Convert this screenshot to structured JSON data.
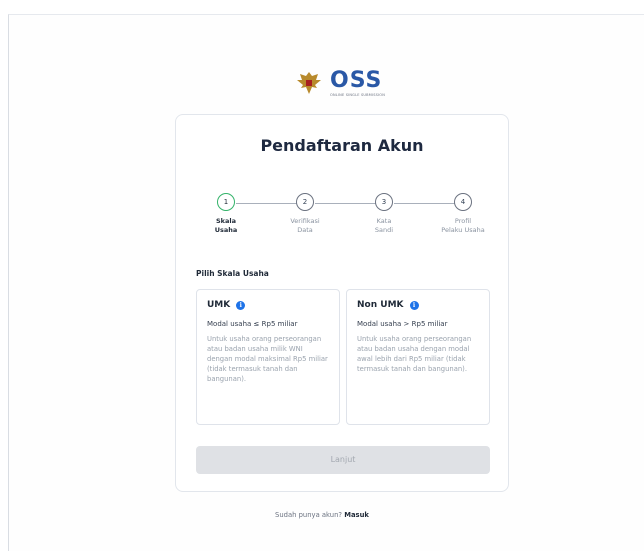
{
  "logo": {
    "brand": "OSS",
    "subtitle": "ONLINE SINGLE SUBMISSION"
  },
  "card": {
    "title": "Pendaftaran Akun",
    "steps": [
      {
        "number": "1",
        "label": "Skala\nUsaha",
        "active": true
      },
      {
        "number": "2",
        "label": "Verifikasi\nData",
        "active": false
      },
      {
        "number": "3",
        "label": "Kata\nSandi",
        "active": false
      },
      {
        "number": "4",
        "label": "Profil\nPelaku Usaha",
        "active": false
      }
    ],
    "section_label": "Pilih Skala Usaha",
    "options": [
      {
        "title": "UMK",
        "subtitle": "Modal usaha ≤ Rp5 miliar",
        "description": "Untuk usaha orang perseorangan atau badan usaha milik WNI dengan modal maksimal Rp5 miliar (tidak termasuk tanah dan bangunan)."
      },
      {
        "title": "Non UMK",
        "subtitle": "Modal usaha > Rp5 miliar",
        "description": "Untuk usaha orang perseorangan atau badan usaha dengan modal awal lebih dari Rp5 miliar (tidak termasuk tanah dan bangunan)."
      }
    ],
    "button_label": "Lanjut"
  },
  "footer": {
    "prompt": "Sudah punya akun?",
    "link": "Masuk"
  },
  "colors": {
    "brand_blue": "#2a58a6",
    "active_step": "#34b36a",
    "info_blue": "#1e73e8"
  }
}
